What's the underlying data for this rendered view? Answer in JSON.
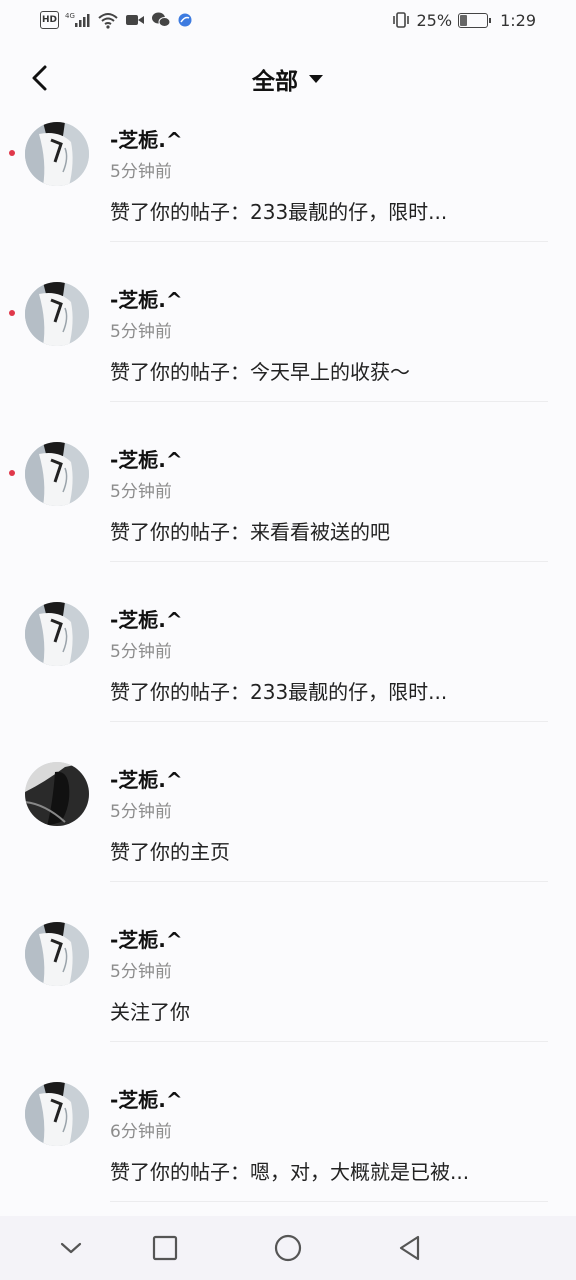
{
  "status_bar": {
    "hd_label": "HD",
    "network": "4G",
    "battery_percent": "25%",
    "battery_level": 0.25,
    "time": "1:29",
    "icons": [
      "hd-icon",
      "signal-icon",
      "wifi-icon",
      "video-icon",
      "wechat-icon",
      "app-icon",
      "vibrate-icon",
      "battery-icon"
    ]
  },
  "header": {
    "title": "全部",
    "back_icon": "back-arrow-icon",
    "dropdown_icon": "caret-down-icon"
  },
  "notifications": [
    {
      "name": "-芝栀.^",
      "time": "5分钟前",
      "text": "赞了你的帖子：233最靓的仔，限时...",
      "unread": true,
      "avatar": "light"
    },
    {
      "name": "-芝栀.^",
      "time": "5分钟前",
      "text": "赞了你的帖子：今天早上的收获～",
      "unread": true,
      "avatar": "light"
    },
    {
      "name": "-芝栀.^",
      "time": "5分钟前",
      "text": "赞了你的帖子：来看看被送的吧",
      "unread": true,
      "avatar": "light"
    },
    {
      "name": "-芝栀.^",
      "time": "5分钟前",
      "text": "赞了你的帖子：233最靓的仔，限时...",
      "unread": false,
      "avatar": "light"
    },
    {
      "name": "-芝栀.^",
      "time": "5分钟前",
      "text": "赞了你的主页",
      "unread": false,
      "avatar": "dark"
    },
    {
      "name": "-芝栀.^",
      "time": "5分钟前",
      "text": "关注了你",
      "unread": false,
      "avatar": "light"
    },
    {
      "name": "-芝栀.^",
      "time": "6分钟前",
      "text": "赞了你的帖子：嗯，对，大概就是已被...",
      "unread": false,
      "avatar": "light"
    }
  ],
  "nav_bar": {
    "icons": [
      "collapse-chevron-icon",
      "recents-square-icon",
      "home-circle-icon",
      "back-triangle-icon"
    ]
  },
  "colors": {
    "unread_dot": "#e0384a",
    "secondary_text": "#8c8c8c",
    "background": "#fbfbfd"
  }
}
